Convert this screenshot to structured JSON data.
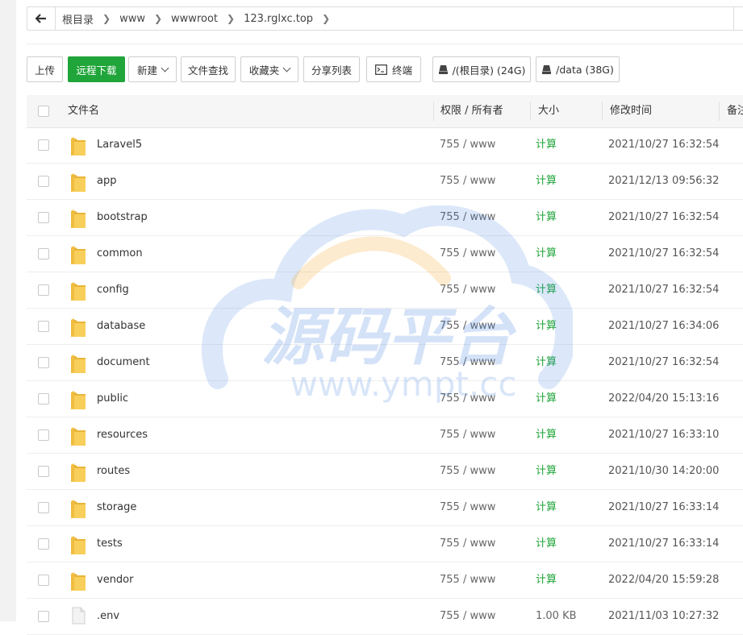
{
  "breadcrumb": {
    "items": [
      "根目录",
      "www",
      "wwwroot",
      "123.rglxc.top"
    ]
  },
  "toolbar": {
    "upload": "上传",
    "remote_download": "远程下载",
    "new": "新建",
    "file_search": "文件查找",
    "favorites": "收藏夹",
    "share_list": "分享列表",
    "terminal": "终端",
    "disk_root": "/(根目录) (24G)",
    "disk_data": "/data (38G)"
  },
  "table": {
    "headers": {
      "name": "文件名",
      "perm": "权限 / 所有者",
      "size": "大小",
      "mtime": "修改时间",
      "remark": "备注"
    },
    "rows": [
      {
        "name": "Laravel5",
        "perm": "755 / www",
        "size": "计算",
        "mtime": "2021/10/27 16:32:54",
        "type": "folder"
      },
      {
        "name": "app",
        "perm": "755 / www",
        "size": "计算",
        "mtime": "2021/12/13 09:56:32",
        "type": "folder"
      },
      {
        "name": "bootstrap",
        "perm": "755 / www",
        "size": "计算",
        "mtime": "2021/10/27 16:32:54",
        "type": "folder"
      },
      {
        "name": "common",
        "perm": "755 / www",
        "size": "计算",
        "mtime": "2021/10/27 16:32:54",
        "type": "folder"
      },
      {
        "name": "config",
        "perm": "755 / www",
        "size": "计算",
        "mtime": "2021/10/27 16:32:54",
        "type": "folder"
      },
      {
        "name": "database",
        "perm": "755 / www",
        "size": "计算",
        "mtime": "2021/10/27 16:34:06",
        "type": "folder"
      },
      {
        "name": "document",
        "perm": "755 / www",
        "size": "计算",
        "mtime": "2021/10/27 16:32:54",
        "type": "folder"
      },
      {
        "name": "public",
        "perm": "755 / www",
        "size": "计算",
        "mtime": "2022/04/20 15:13:16",
        "type": "folder"
      },
      {
        "name": "resources",
        "perm": "755 / www",
        "size": "计算",
        "mtime": "2021/10/27 16:33:10",
        "type": "folder"
      },
      {
        "name": "routes",
        "perm": "755 / www",
        "size": "计算",
        "mtime": "2021/10/30 14:20:00",
        "type": "folder"
      },
      {
        "name": "storage",
        "perm": "755 / www",
        "size": "计算",
        "mtime": "2021/10/27 16:33:14",
        "type": "folder"
      },
      {
        "name": "tests",
        "perm": "755 / www",
        "size": "计算",
        "mtime": "2021/10/27 16:33:14",
        "type": "folder"
      },
      {
        "name": "vendor",
        "perm": "755 / www",
        "size": "计算",
        "mtime": "2022/04/20 15:59:28",
        "type": "folder"
      },
      {
        "name": ".env",
        "perm": "755 / www",
        "size": "1.00 KB",
        "mtime": "2021/11/03 10:27:32",
        "type": "file"
      }
    ]
  },
  "watermark": {
    "title": "源码平台",
    "url": "www.ympt.cc"
  },
  "colors": {
    "accent_green": "#20a53a",
    "folder_yellow": "#f5c242",
    "watermark_blue": "#3f7fe0",
    "watermark_orange": "#f5a524"
  }
}
